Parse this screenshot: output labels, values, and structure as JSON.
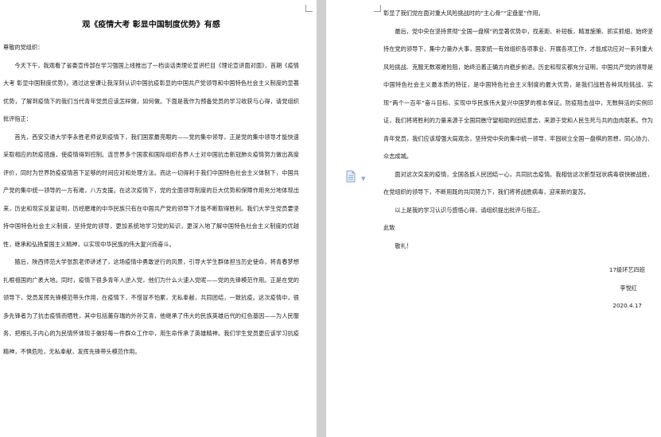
{
  "left_page": {
    "title": "观《疫情大考 彰显中国制度优势》有感",
    "salutation": "尊敬的党组织：",
    "paragraphs": [
      "今天下午，我观看了省委宣传部在学习强国上线推出了一档谈话类理论宣讲栏目《理论宣讲面对面》，首期《疫情大考 彰显中国制度优势》。通过这堂课让我深刻认识中国抗疫彰显的中国共产党领导和中国特色社会主义制度的显著优势，了解到疫情下的我们当代青年党员应该怎样做，如何做。下面是我作为预备党员的学习收获与心得，请党组织批评指正：",
      "首先，西安交通大学李永胜老师说到疫情下，我们国家最亮眼的——党的集中领导，正是党的集中领导才能快速采取相应的防疫措施，使疫情得到控制。连世界多个国家和国际组织各界人士对中国抗击新冠肺炎疫情努力做出高度评价，同时为世界防疫疫情首下足够的时间应对和处理方法。而这一切得利于我们中国特色社会主义体制下，中国共产党的集中统一领导的一方有难，八方支援。在这次疫情下，党的全面领导制度的巨大优势和保障作用充分地体现出来，历史和现实反复证明，历经磨难的中华民族只有在中国共产党的领导下才能不断取得胜利。我们大学生党员要坚持中国特色社会主义制度，坚持党的领导，更加系统地学习党的知识，更深入地了解中国特色社会主义制度的优越性，继承和弘扬爱国主义精神，以实现中华民族的伟大复兴而奋斗。",
      "随后，陕西师范大学张凯老师讲述了，这场疫情中勇敢逆行的风景，引导大学生群体担当历史使命，将青春梦想扎根祖国的广袤大地。同时，疫情下很多青年人逆入党，他们为什么火速入党呢——党的先锋模范作用。正是在党的领导下，党员发挥先锋模范带头作用，在疫情下，不惜冒不怕累，无私奉献，共同团结，一致抗疫。这次疫情中，很多先锋者为了抗击疫情而牺牲，其中包括董存瑞的外孙艾青，他继承了伟大的民族英雄后代的红色基因——为人民服务，把根扎于内心的为民情怀体现于做好每一件群众工作中，用生命传承了英雄精神。我们学生党员更应该学习抗疫精神，不惧危险，无私奉献，发挥先锋带头模范作用。"
    ]
  },
  "right_page": {
    "paragraphs": [
      "彰显了我们党在面对重大风险挑战时的“主心骨”“定盘星”作用。",
      "最后，党中央在坚持贯彻“全国一盘棋”的显著优势中，找差距、补短板，精准施策、抓实抓细，始终坚持在党的领导下，集中力量办大事，国家统一有效组织各项事业、开展各项工作，才能成功应对一系列重大风险挑战、克服无数艰难险阻，始终沿着正确方向稳步前进。历史和现实都充分证明，中国共产党的领导是中国特色社会主义最本质的特征，是中国特色社会主义制度的最大优势，是我们战胜各种风险挑战、实现“两个一百年”奋斗目标、实现中华民族伟大复兴中国梦的根本保证。防疫阻击战中，无数鲜活的实例印证，我们将将胜利的力量来源于全国同胞守望相助的团结意志，来源于党和人民生死与共的血肉联系。作为青年党员，我们应该增强大局观念，坚持党中央的集中统一领导，牢固树立全国一盘棋的思想，同心协力、众志成城。",
      "面对这次突发的疫情，全国各族人民团结一心，共同抗击疫情。我相信这次新型冠状病毒很快被战胜，在党组织的领导下，不断用既的共同努力下，我们将将战胜病毒，迎来新的复苏。",
      "以上是我的学习认识与感悟心得，请组织提出批评与指正。"
    ],
    "closing_1": "此致",
    "closing_2": "敬礼！",
    "signature_class": "17级环艺四班",
    "signature_name": "李悦红",
    "signature_date": "2020.4.17"
  },
  "icons": {
    "paste_options": "document-paste-icon",
    "dropdown": "chevron-down-icon"
  },
  "colors": {
    "page_bg": "#ffffff",
    "workspace_bg": "#d9d9d9",
    "icon_color": "#8fa8c8"
  }
}
